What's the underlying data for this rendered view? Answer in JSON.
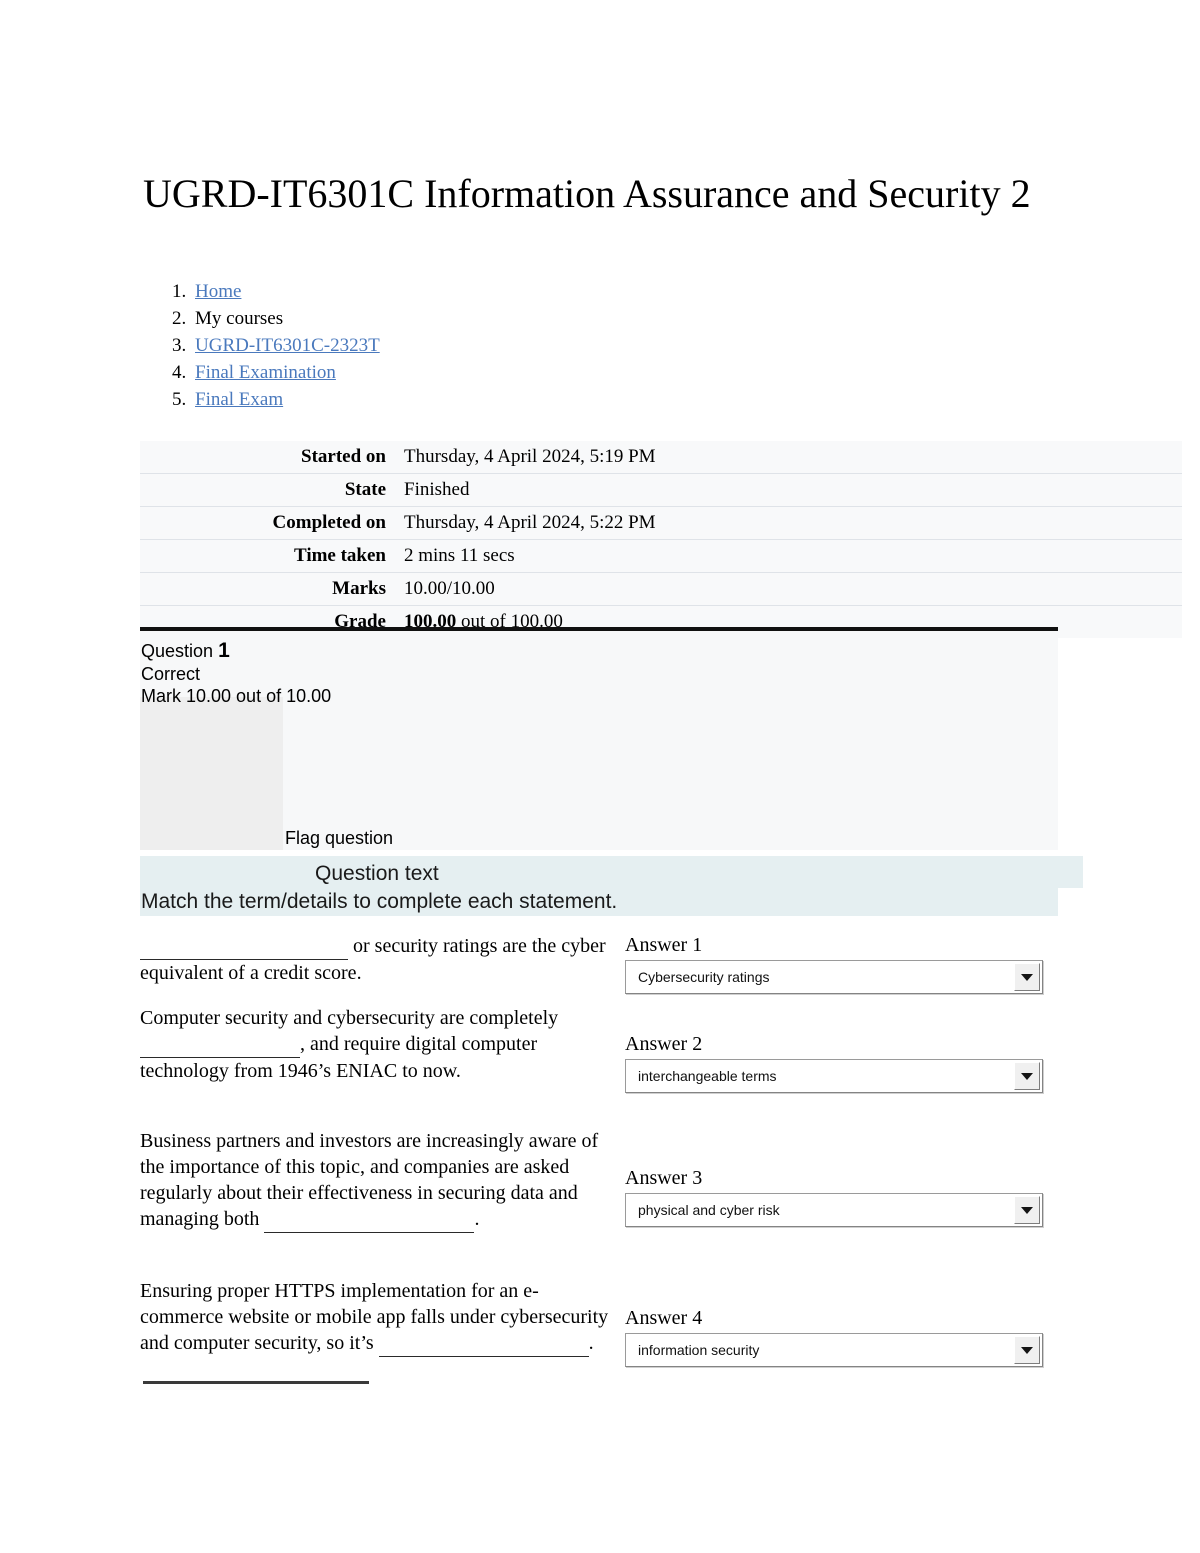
{
  "page": {
    "title": "UGRD-IT6301C Information Assurance and Security 2"
  },
  "breadcrumb": {
    "items": [
      {
        "label": "Home",
        "is_link": true
      },
      {
        "label": "My courses",
        "is_link": false
      },
      {
        "label": "UGRD-IT6301C-2323T",
        "is_link": true
      },
      {
        "label": "Final Examination",
        "is_link": true
      },
      {
        "label": "Final Exam",
        "is_link": true
      }
    ],
    "link_color": "#4a79bd"
  },
  "summary": {
    "rows": [
      {
        "label": "Started on",
        "value": "Thursday, 4 April 2024, 5:19 PM"
      },
      {
        "label": "State",
        "value": "Finished"
      },
      {
        "label": "Completed on",
        "value": "Thursday, 4 April 2024, 5:22 PM"
      },
      {
        "label": "Time taken",
        "value": "2 mins 11 secs"
      },
      {
        "label": "Marks",
        "value": "10.00/10.00"
      }
    ],
    "grade_label": "Grade",
    "grade_value_strong": "100.00",
    "grade_value_rest": " out of 100.00"
  },
  "question": {
    "number_label": "Question",
    "number": "1",
    "state": "Correct",
    "mark": "Mark 10.00 out of 10.00",
    "flag_label": "Flag question",
    "text_label": "Question text",
    "text_body": "Match the term/details to complete each statement.",
    "highlight_color": "#e5eff1"
  },
  "matching": {
    "rows": [
      {
        "stem_before": "",
        "stem_after": " or security ratings are the cyber equivalent of a credit score.",
        "answer_label": "Answer 1",
        "selected": "Cybersecurity ratings"
      },
      {
        "stem_before": "Computer security and cybersecurity are completely ",
        "stem_after": ", and require digital computer technology from 1946’s ENIAC to now.",
        "answer_label": "Answer 2",
        "selected": "interchangeable terms"
      },
      {
        "stem_before": "Business partners and investors are increasingly aware of the importance of this topic, and companies are asked regularly about their effectiveness in securing data and managing both ",
        "stem_after": ".",
        "answer_label": "Answer 3",
        "selected": "physical and cyber risk"
      },
      {
        "stem_before": "Ensuring proper HTTPS implementation for an e-commerce website or mobile app falls under cybersecurity and computer security, so it’s ",
        "stem_after": ".",
        "answer_label": "Answer 4",
        "selected": "information security"
      }
    ]
  }
}
